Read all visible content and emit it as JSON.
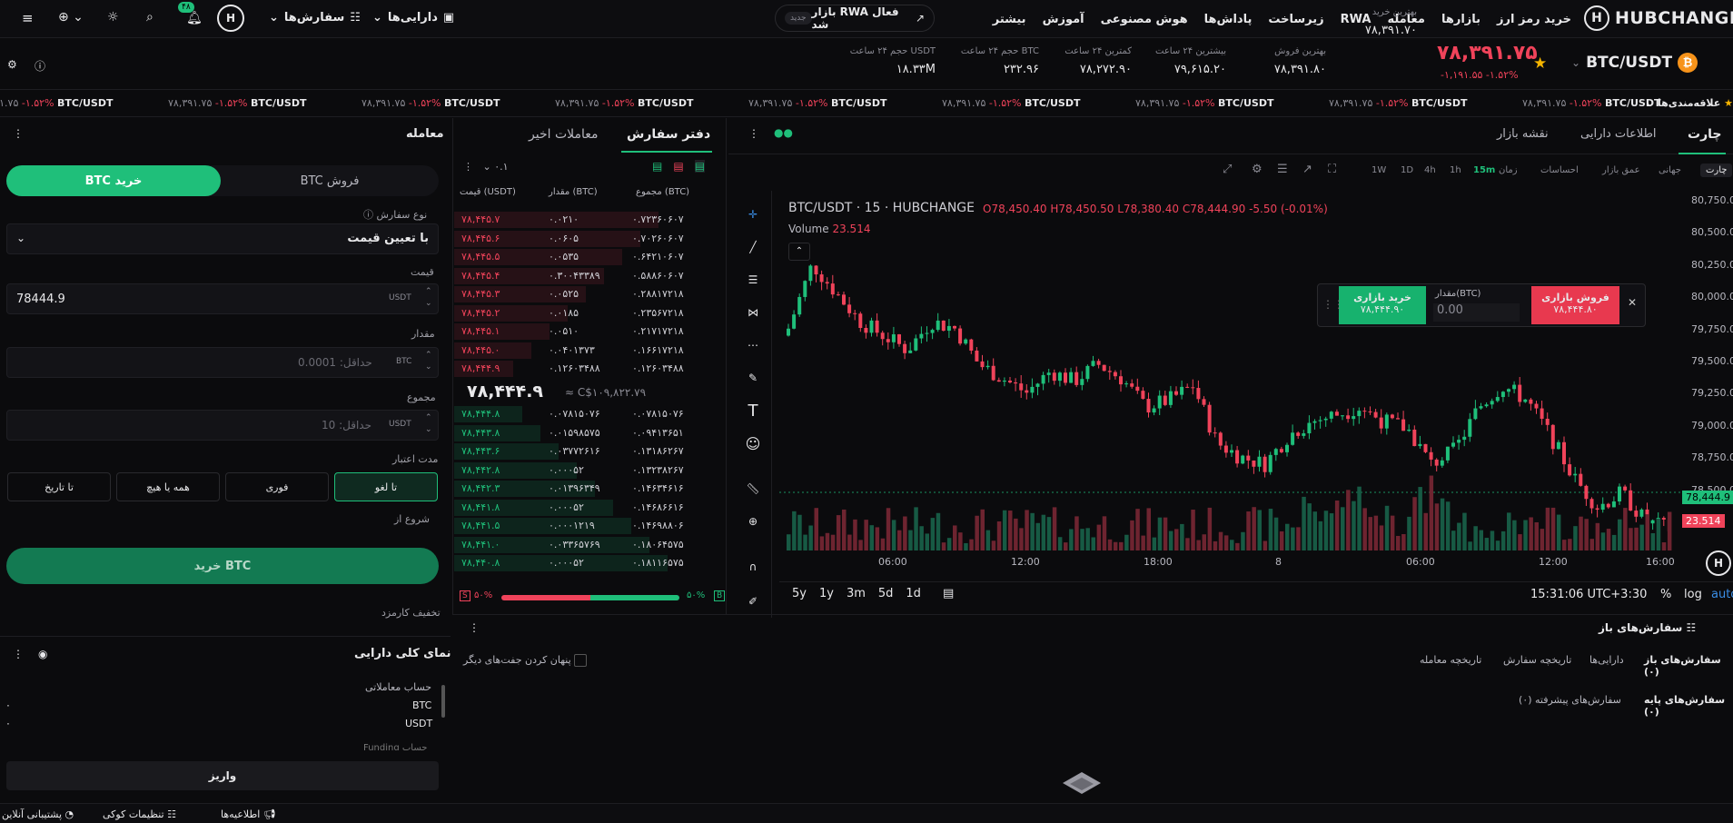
{
  "header": {
    "brand": "HUBCHANGE",
    "nav": [
      "خرید رمز ارز",
      "بازارها",
      "معامله",
      "RWA",
      "زیرساخت",
      "پاداش‌ها",
      "هوش مصنوعی",
      "آموزش",
      "بیشتر"
    ],
    "rwa_text": "بازار RWA فعال شد",
    "rwa_badge": "جدید",
    "assets": "دارایی‌ها",
    "orders": "سفارش‌ها",
    "badge": "۴۸"
  },
  "ticker": {
    "pair": "BTC/USDT",
    "price": "۷۸,۳۹۱.۷۵",
    "change": "-۱,۱۹۱.۵۵ -۱.۵۲%",
    "stats": [
      {
        "label": "بهترین خرید",
        "value": "۷۸,۳۹۱.۷۰"
      },
      {
        "label": "بهترین فروش",
        "value": "۷۸,۳۹۱.۸۰"
      },
      {
        "label": "بیشترین ۲۴ ساعت",
        "value": "۷۹,۶۱۵.۲۰"
      },
      {
        "label": "کمترین ۲۴ ساعت",
        "value": "۷۸,۲۷۲.۹۰"
      },
      {
        "label": "حجم ۲۴ ساعت BTC",
        "value": "۲۳۲.۹۶"
      },
      {
        "label": "حجم ۲۴ ساعت USDT",
        "value": "۱۸.۳۳M"
      }
    ]
  },
  "marquee": {
    "fav": "علاقه‌مندی‌ها",
    "pair": "BTC/USDT",
    "pct": "-۱.۵۲%",
    "price": "۷۸,۳۹۱.۷۵"
  },
  "chart_tabs": [
    "چارت",
    "اطلاعات دارایی",
    "نقشه بازار"
  ],
  "chart_toolbar": {
    "chart": "چارت",
    "world": "جهانی",
    "depth": "عمق بازار",
    "sentiment": "احساسات",
    "time": "زمان",
    "intervals": [
      "15m",
      "1h",
      "4h",
      "1D",
      "1W"
    ]
  },
  "chart": {
    "title": "BTC/USDT · 15 · HUBCHANGE",
    "ohlc": "O78,450.40 H78,450.50 L78,380.40 C78,444.90 -5.50 (-0.01%)",
    "volume_label": "Volume",
    "volume_value": "23.514",
    "yticks": [
      "80,750.00",
      "80,500.00",
      "80,250.00",
      "80,000.00",
      "79,750.00",
      "79,500.00",
      "79,250.00",
      "79,000.00",
      "78,750.00",
      "78,500.00"
    ],
    "last_price": "78,444.9",
    "last_vol": "23.514",
    "xticks": [
      "06:00",
      "12:00",
      "18:00",
      "8",
      "06:00",
      "12:00",
      "16:00"
    ],
    "ranges": [
      "5y",
      "1y",
      "3m",
      "5d",
      "1d"
    ],
    "clock": "15:31:06 UTC+3:30",
    "pct": "%",
    "log": "log",
    "auto": "auto"
  },
  "quick": {
    "sell": "فروش بازاری",
    "sell_price": "۷۸,۴۴۴.۸۰",
    "buy": "خرید بازاری",
    "buy_price": "۷۸,۴۴۴.۹۰",
    "amount_label": "مقدار(BTC)",
    "amount": "0.00"
  },
  "orderbook": {
    "tab1": "دفتر سفارش",
    "tab2": "معاملات اخیر",
    "precision": "۰.۱",
    "h_price": "قیمت (USDT)",
    "h_amount": "مقدار (BTC)",
    "h_total": "مجموع (BTC)",
    "asks": [
      [
        "۷۸,۴۴۵.۷",
        "۰.۰۲۱۰",
        "۰.۷۲۳۶۰۶۰۷"
      ],
      [
        "۷۸,۴۴۵.۶",
        "۰.۰۶۰۵",
        "۰.۷۰۲۶۰۶۰۷"
      ],
      [
        "۷۸,۴۴۵.۵",
        "۰.۰۵۳۵",
        "۰.۶۴۲۱۰۶۰۷"
      ],
      [
        "۷۸,۴۴۵.۴",
        "۰.۳۰۰۴۳۳۸۹",
        "۰.۵۸۸۶۰۶۰۷"
      ],
      [
        "۷۸,۴۴۵.۳",
        "۰.۰۵۲۵",
        "۰.۲۸۸۱۷۲۱۸"
      ],
      [
        "۷۸,۴۴۵.۲",
        "۰.۰۱۸۵",
        "۰.۲۳۵۶۷۲۱۸"
      ],
      [
        "۷۸,۴۴۵.۱",
        "۰.۰۵۱۰",
        "۰.۲۱۷۱۷۲۱۸"
      ],
      [
        "۷۸,۴۴۵.۰",
        "۰.۰۴۰۱۳۷۳",
        "۰.۱۶۶۱۷۲۱۸"
      ],
      [
        "۷۸,۴۴۴.۹",
        "۰.۱۲۶۰۳۴۸۸",
        "۰.۱۲۶۰۳۴۸۸"
      ]
    ],
    "mid": "۷۸,۴۴۴.۹",
    "mid_sub": "≈ C$۱۰۹,۸۲۲.۷۹",
    "bids": [
      [
        "۷۸,۴۴۴.۸",
        "۰.۰۷۸۱۵۰۷۶",
        "۰.۰۷۸۱۵۰۷۶"
      ],
      [
        "۷۸,۴۴۳.۸",
        "۰.۰۱۵۹۸۵۷۵",
        "۰.۰۹۴۱۳۶۵۱"
      ],
      [
        "۷۸,۴۴۳.۶",
        "۰.۰۳۷۷۲۶۱۶",
        "۰.۱۳۱۸۶۲۶۷"
      ],
      [
        "۷۸,۴۴۲.۸",
        "۰.۰۰۰۵۲",
        "۰.۱۳۲۳۸۲۶۷"
      ],
      [
        "۷۸,۴۴۲.۳",
        "۰.۰۱۳۹۶۳۴۹",
        "۰.۱۴۶۳۴۶۱۶"
      ],
      [
        "۷۸,۴۴۱.۸",
        "۰.۰۰۰۵۲",
        "۰.۱۴۶۸۶۶۱۶"
      ],
      [
        "۷۸,۴۴۱.۵",
        "۰.۰۰۰۱۲۱۹",
        "۰.۱۴۶۹۸۸۰۶"
      ],
      [
        "۷۸,۴۴۱.۰",
        "۰.۰۳۳۶۵۷۶۹",
        "۰.۱۸۰۶۴۵۷۵"
      ],
      [
        "۷۸,۴۴۰.۸",
        "۰.۰۰۰۵۲",
        "۰.۱۸۱۱۶۵۷۵"
      ]
    ],
    "sell_pct": "۵۰%",
    "buy_pct": "۵۰%"
  },
  "trade": {
    "title": "معامله",
    "sell_tab": "BTC فروش",
    "buy_tab": "BTC خرید",
    "order_type_label": "نوع سفارش",
    "order_type": "با تعیین قیمت",
    "price_label": "قیمت",
    "price": "78444.9",
    "amount_label": "مقدار",
    "amount_ph": "حداقل: 0.0001",
    "total_label": "مجموع",
    "total_ph": "حداقل: 10",
    "usdt": "USDT",
    "btc": "BTC",
    "validity_label": "مدت اعتبار",
    "validity": [
      "تا لغو",
      "فوری",
      "همه یا هیچ",
      "تا تاریخ"
    ],
    "start_label": "شروع از",
    "submit": "خرید BTC",
    "fee": "تخفیف کارمزد"
  },
  "assets": {
    "title": "نمای کلی دارایی",
    "account": "حساب معاملاتی",
    "rows": [
      [
        "BTC",
        "۰"
      ],
      [
        "USDT",
        "۰"
      ]
    ],
    "deposit": "واریز",
    "funding": "Funding حساب"
  },
  "orders": {
    "title": "سفارش‌های باز",
    "tabs": [
      "سفارش‌های باز (۰)",
      "دارایی‌ها",
      "تاریخچه سفارش",
      "تاریخچه معامله"
    ],
    "hide": "پنهان کردن جفت‌های دیگر",
    "sub": [
      "سفارش‌های پایه (۰)",
      "سفارش‌های پیشرفته (۰)"
    ]
  },
  "footer": {
    "support": "پشتیبانی آنلاین",
    "cookies": "تنظیمات کوکی",
    "notices": "اطلاعیه‌ها"
  },
  "colors": {
    "green": "#1fbf7a",
    "red": "#f0435a",
    "bg": "#0b0b0d"
  }
}
